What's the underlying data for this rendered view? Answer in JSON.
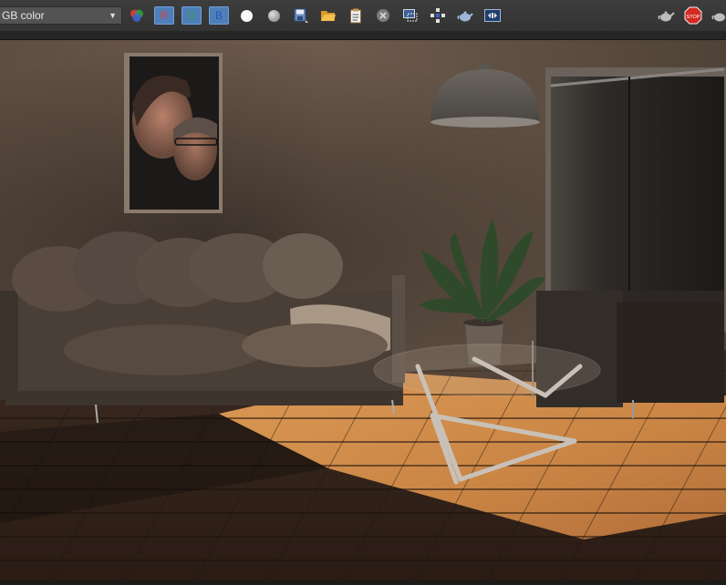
{
  "toolbar": {
    "channel_value": "GB color",
    "channel_buttons": [
      "R",
      "G",
      "B"
    ],
    "icons": [
      "color-channels-icon",
      "white-dot-icon",
      "gray-dot-icon",
      "save-icon",
      "open-folder-icon",
      "clipboard-icon",
      "clear-icon",
      "region-render-icon",
      "lens-effects-icon",
      "teapot-icon",
      "history-icon",
      "teapot-render-icon",
      "stop-icon",
      "teapot-last-icon"
    ],
    "stop_label": "STOP"
  },
  "colors": {
    "accent": "#4f7fb8",
    "toolbar_bg": "#383838",
    "stop_red": "#d22a20"
  },
  "render": {
    "description_visible": false
  }
}
